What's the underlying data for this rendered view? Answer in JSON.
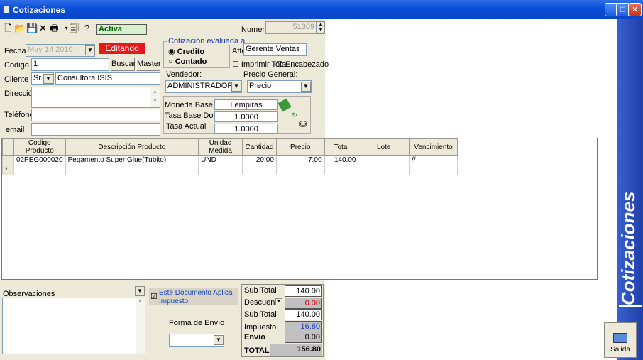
{
  "window": {
    "title": "Cotizaciones",
    "sidebar_text": "Cotizaciones",
    "exit_label": "Salida"
  },
  "toolbar": {
    "status": "Activa",
    "numero_label": "Numero",
    "numero_value": "51369"
  },
  "header": {
    "fecha_label": "Fecha",
    "fecha_value": "May 14 2010",
    "editando": "Editando",
    "codigo_label": "Codigo",
    "codigo_value": "1",
    "buscar": "Buscar",
    "master": "Master",
    "cliente_label": "Cliente",
    "cliente_title": "Sr.",
    "cliente_value": "Consultora ISIS",
    "direccion_label": "Dirección",
    "telefono_label": "Teléfono",
    "email_label": "email"
  },
  "evaluada": {
    "legend": "Cotización evaluada al",
    "credito": "Credito",
    "contado": "Contado",
    "atte_label": "Atte:",
    "atte_value": "Gerente Ventas",
    "imprimir_total": "Imprimir Total",
    "encabezado": "Encabezado"
  },
  "vendedor": {
    "label": "Vendedor:",
    "value": "ADMINISTRADOR",
    "precio_label": "Precio General:",
    "precio_value": "Precio"
  },
  "moneda": {
    "base_doc_label": "Moneda Base Doc",
    "base_doc_value": "Lempiras",
    "tasa_base_label": "Tasa Base Doc",
    "tasa_base_value": "1.0000",
    "tasa_actual_label": "Tasa Actual",
    "tasa_actual_value": "1.0000"
  },
  "grid": {
    "columns": [
      "Codigo Producto",
      "Descripción Producto",
      "Unidad Medida",
      "Cantidad",
      "Precio",
      "Total",
      "Lote",
      "Vencimiento"
    ],
    "rows": [
      [
        "02PEG000020",
        "Pegamento Super Glue(Tubito)",
        "UND",
        "20.00",
        "7.00",
        "140.00",
        "",
        "//"
      ]
    ],
    "new_row_marker": "*"
  },
  "footer": {
    "observaciones_label": "Observaciones",
    "impuesto_label": "Este Documento Aplica Impuesto",
    "forma_envio_label": "Forma de Envío"
  },
  "totals": {
    "subtotal_label": "Sub Total",
    "subtotal_value": "140.00",
    "descuento_label": "Descuento",
    "descuento_value": "0.00",
    "subtotal2_label": "Sub Total",
    "subtotal2_value": "140.00",
    "impuesto_label": "Impuesto",
    "impuesto_value": "16.80",
    "envio_label": "Envio",
    "envio_value": "0.00",
    "total_label": "TOTAL",
    "total_value": "156.80"
  },
  "colors": {
    "titlebar": "#0a4fd8",
    "editando_bg": "#e81818",
    "descuento_value": "#cc0000",
    "impuesto_value": "#1a3fc0"
  }
}
